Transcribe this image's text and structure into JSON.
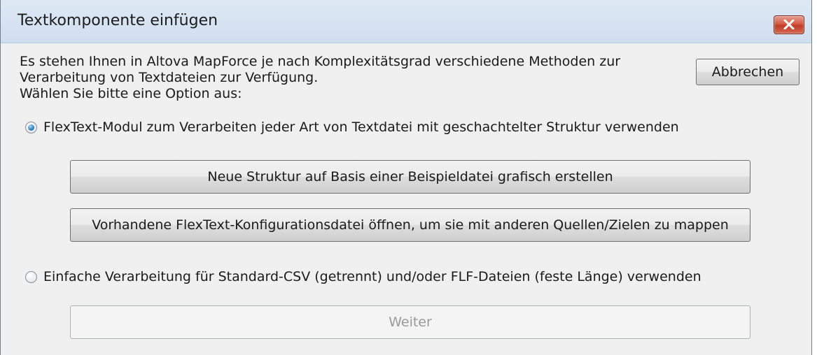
{
  "dialog": {
    "title": "Textkomponente einfügen",
    "close_icon": "close-x-icon",
    "intro_lines": [
      "Es stehen Ihnen in Altova MapForce je nach Komplexitätsgrad verschiedene Methoden zur",
      "Verarbeitung von Textdateien zur Verfügung.",
      "Wählen Sie bitte eine Option aus:"
    ],
    "cancel_label": "Abbrechen",
    "option_flextext": {
      "label": "FlexText-Modul zum Verarbeiten jeder Art von Textdatei mit geschachtelter Struktur verwenden",
      "selected": true
    },
    "create_structure_label": "Neue Struktur auf Basis einer Beispieldatei grafisch erstellen",
    "open_config_label": "Vorhandene FlexText-Konfigurationsdatei öffnen, um sie mit anderen Quellen/Zielen zu mappen",
    "option_simple": {
      "label": "Einfache Verarbeitung für Standard-CSV (getrennt) und/oder FLF-Dateien (feste Länge) verwenden",
      "selected": false
    },
    "continue_label": "Weiter",
    "colors": {
      "title_bar": "#dbe6f3",
      "close_button": "#c94a36",
      "dialog_bg": "#f0f0f0",
      "radio_dot": "#2f7fc0"
    }
  }
}
